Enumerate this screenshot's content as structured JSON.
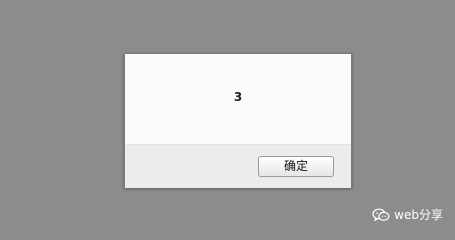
{
  "dialog": {
    "message": "3",
    "ok_label": "确定"
  },
  "watermark": {
    "icon": "wechat-icon",
    "text": "web分享"
  }
}
